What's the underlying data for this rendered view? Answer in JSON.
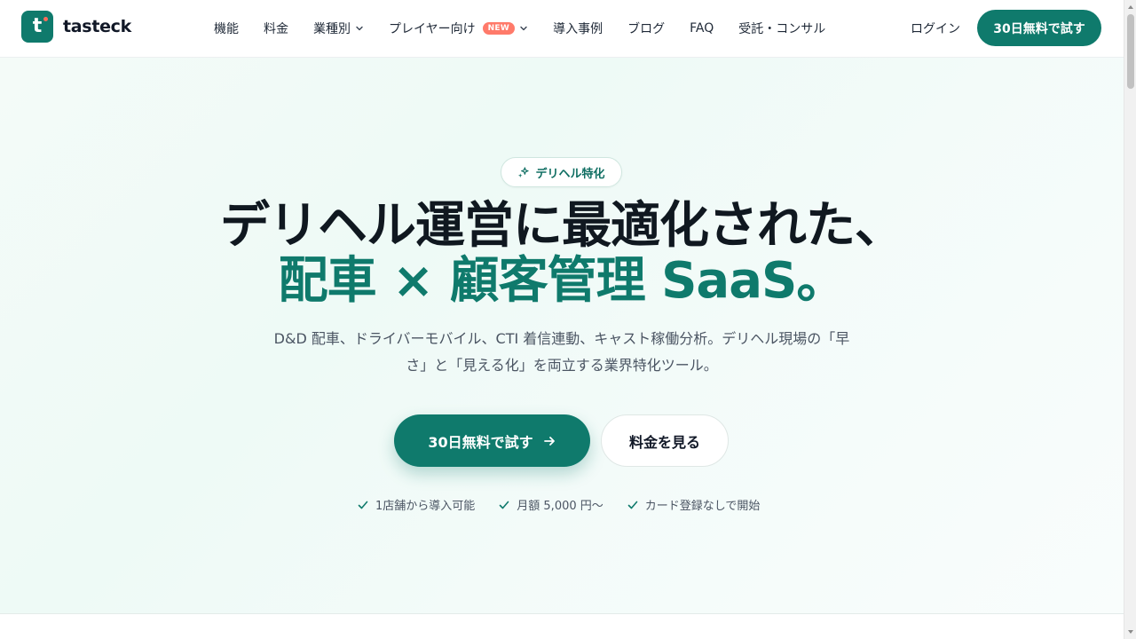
{
  "header": {
    "logo_text": "tasteck",
    "logo_letter": "t",
    "nav": [
      {
        "label": "機能",
        "dropdown": false
      },
      {
        "label": "料金",
        "dropdown": false
      },
      {
        "label": "業種別",
        "dropdown": true
      },
      {
        "label": "プレイヤー向け",
        "dropdown": true,
        "badge": "NEW"
      },
      {
        "label": "導入事例",
        "dropdown": false
      },
      {
        "label": "ブログ",
        "dropdown": false
      },
      {
        "label": "FAQ",
        "dropdown": false
      },
      {
        "label": "受託・コンサル",
        "dropdown": false
      }
    ],
    "login": "ログイン",
    "cta": "30日無料で試す"
  },
  "hero": {
    "pill": "デリヘル特化",
    "title_line1": "デリヘル運営に最適化された、",
    "title_line2": "配車 × 顧客管理 SaaS。",
    "lead_line1": "D&D 配車、ドライバーモバイル、CTI 着信連動、キャスト稼働分析。デリヘル現場の「早",
    "lead_line2": "さ」と「見える化」を両立する業界特化ツール。",
    "primary_cta": "30日無料で試す",
    "secondary_cta": "料金を見る",
    "checks": [
      "1店舗から導入可能",
      "月額 5,000 円〜",
      "カード登録なしで開始"
    ]
  },
  "colors": {
    "brand": "#0f7a6c",
    "badge": "#ff7a6a",
    "text": "#111827"
  },
  "icons": {
    "logo": "logo-mark-icon",
    "pill": "sparkle-icon",
    "dropdown": "chevron-down-icon",
    "cta_arrow": "arrow-right-icon",
    "check": "check-icon"
  }
}
